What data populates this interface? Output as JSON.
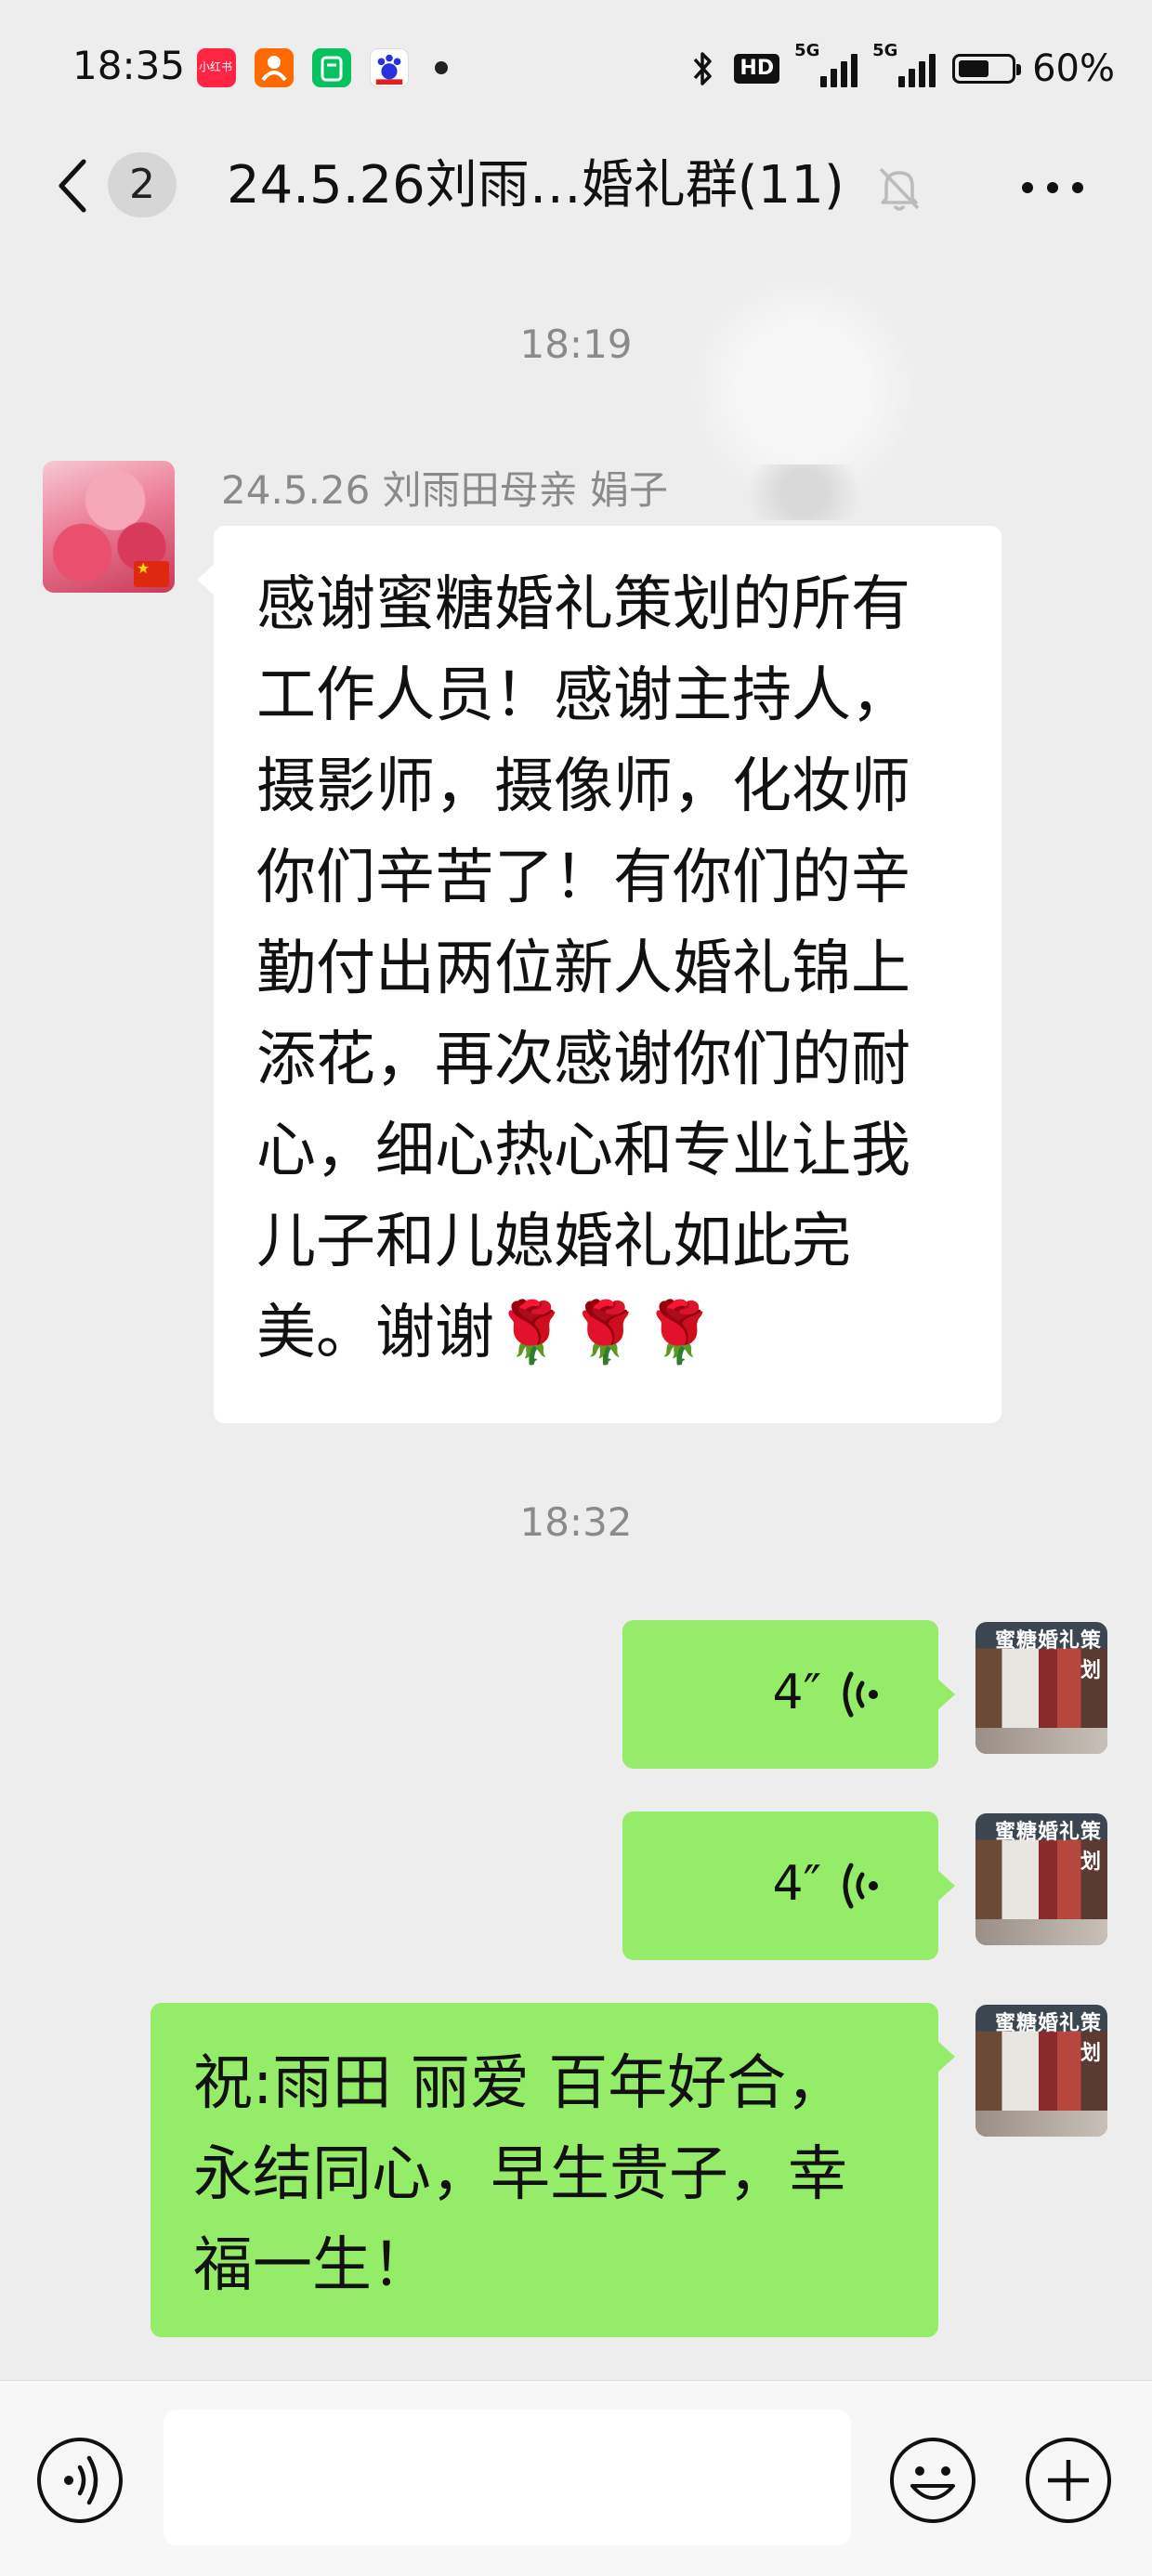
{
  "status_bar": {
    "time": "18:35",
    "app_icons": [
      {
        "name": "xiaohongshu-app-icon",
        "color": "#ff2442",
        "label": "小红书"
      },
      {
        "name": "taobao-app-icon",
        "color": "#ff6a00",
        "label": ""
      },
      {
        "name": "wechat-mini-app-icon",
        "color": "#07c160",
        "label": ""
      },
      {
        "name": "baidu-app-icon",
        "color": "#2932e1",
        "label": ""
      }
    ],
    "hd_label": "HD",
    "signal_label": "5G",
    "battery_percent": 0.6,
    "battery_text": "60%"
  },
  "nav": {
    "unread_count": "2",
    "title": "24.5.26刘雨…婚礼群(11)"
  },
  "messages": [
    {
      "type": "timestamp",
      "text": "18:19"
    },
    {
      "type": "text",
      "side": "left",
      "sender": "24.5.26 刘雨田母亲 娟子",
      "text": "感谢蜜糖婚礼策划的所有工作人员！感谢主持人，摄影师，摄像师，化妆师你们辛苦了！有你们的辛勤付出两位新人婚礼锦上添花，再次感谢你们的耐心，细心热心和专业让我儿子和儿媳婚礼如此完美。谢谢🌹🌹🌹"
    },
    {
      "type": "timestamp",
      "text": "18:32"
    },
    {
      "type": "voice",
      "side": "right",
      "duration": "4″"
    },
    {
      "type": "voice",
      "side": "right",
      "duration": "4″"
    },
    {
      "type": "text",
      "side": "right",
      "text": "祝:雨田 丽爱 百年好合，永结同心，早生贵子，幸福一生！"
    }
  ],
  "store_avatar_sign": "蜜糖婚礼策划",
  "colors": {
    "background": "#ededed",
    "bubble_self": "#95ec69",
    "bubble_other": "#ffffff",
    "timestamp": "#8a8a8a"
  },
  "input": {
    "placeholder": ""
  }
}
